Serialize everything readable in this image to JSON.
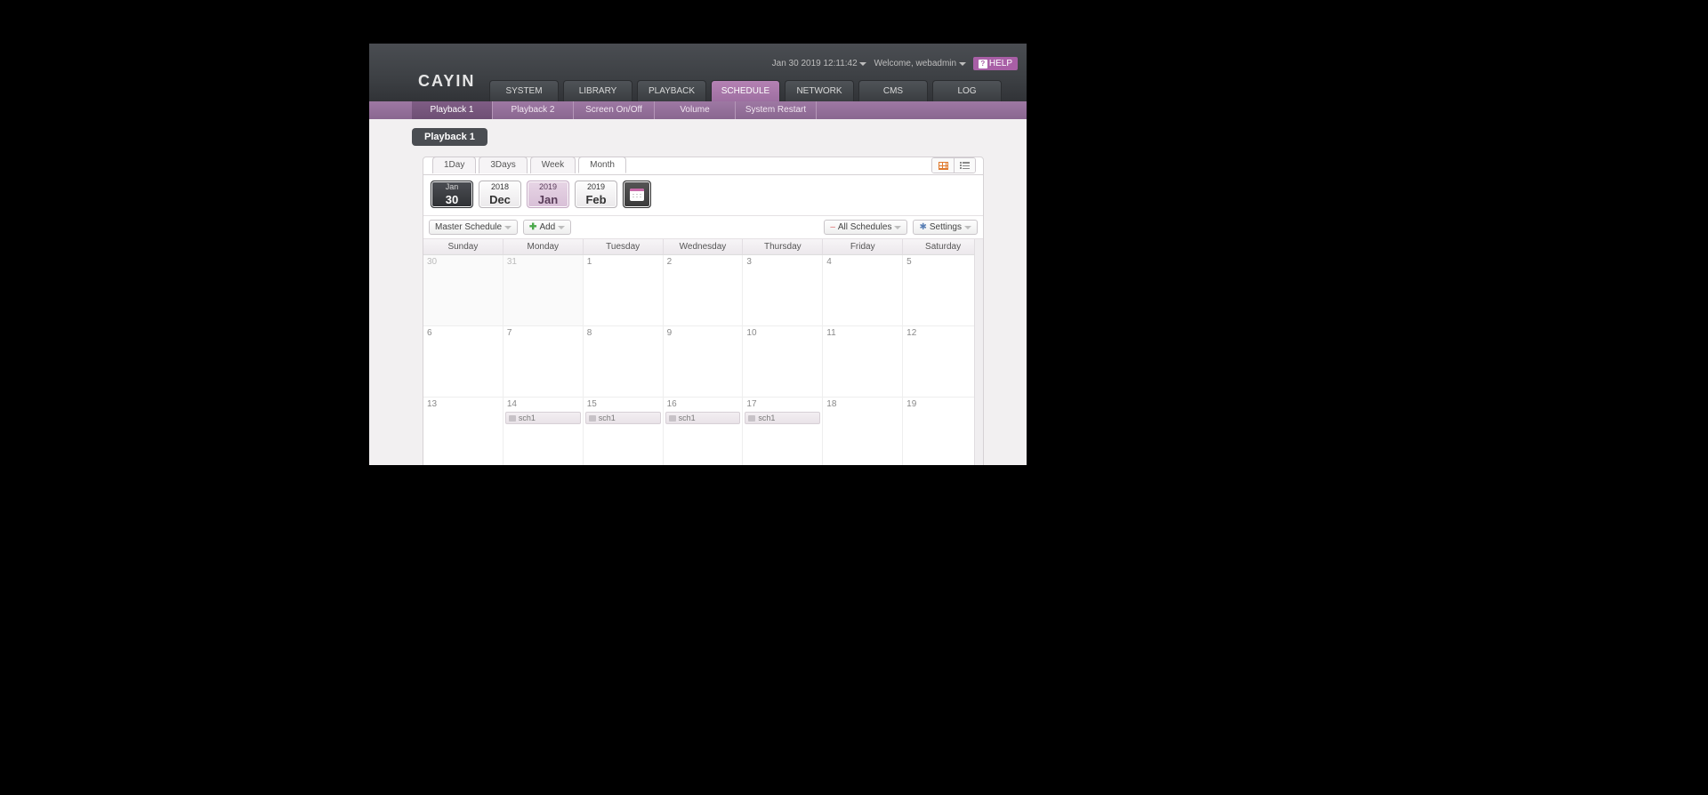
{
  "header": {
    "logo": "CAYIN",
    "datetime": "Jan 30 2019 12:11:42",
    "welcome": "Welcome, webadmin",
    "help": "HELP"
  },
  "mainnav": {
    "items": [
      {
        "label": "SYSTEM",
        "active": false
      },
      {
        "label": "LIBRARY",
        "active": false
      },
      {
        "label": "PLAYBACK",
        "active": false
      },
      {
        "label": "SCHEDULE",
        "active": true
      },
      {
        "label": "NETWORK",
        "active": false
      },
      {
        "label": "CMS",
        "active": false
      },
      {
        "label": "LOG",
        "active": false
      }
    ]
  },
  "subnav": {
    "items": [
      {
        "label": "Playback 1",
        "active": true
      },
      {
        "label": "Playback 2",
        "active": false
      },
      {
        "label": "Screen On/Off",
        "active": false
      },
      {
        "label": "Volume",
        "active": false
      },
      {
        "label": "System Restart",
        "active": false
      }
    ]
  },
  "page_title": "Playback 1",
  "viewtabs": {
    "items": [
      {
        "label": "1Day",
        "active": false
      },
      {
        "label": "3Days",
        "active": false
      },
      {
        "label": "Week",
        "active": false
      },
      {
        "label": "Month",
        "active": true
      }
    ]
  },
  "navpills": {
    "today": {
      "top": "Jan",
      "bot": "30"
    },
    "prev": {
      "top": "2018",
      "bot": "Dec"
    },
    "curr": {
      "top": "2019",
      "bot": "Jan"
    },
    "next": {
      "top": "2019",
      "bot": "Feb"
    }
  },
  "toolbar": {
    "master": "Master Schedule",
    "add": "Add",
    "all": "All Schedules",
    "settings": "Settings"
  },
  "calendar": {
    "days": [
      "Sunday",
      "Monday",
      "Tuesday",
      "Wednesday",
      "Thursday",
      "Friday",
      "Saturday"
    ],
    "cells": [
      {
        "n": "30",
        "other": true
      },
      {
        "n": "31",
        "other": true
      },
      {
        "n": "1"
      },
      {
        "n": "2"
      },
      {
        "n": "3"
      },
      {
        "n": "4"
      },
      {
        "n": "5"
      },
      {
        "n": "6"
      },
      {
        "n": "7"
      },
      {
        "n": "8"
      },
      {
        "n": "9"
      },
      {
        "n": "10"
      },
      {
        "n": "11"
      },
      {
        "n": "12"
      },
      {
        "n": "13"
      },
      {
        "n": "14",
        "ev": "sch1"
      },
      {
        "n": "15",
        "ev": "sch1"
      },
      {
        "n": "16",
        "ev": "sch1"
      },
      {
        "n": "17",
        "ev": "sch1"
      },
      {
        "n": "18"
      },
      {
        "n": "19"
      }
    ]
  }
}
